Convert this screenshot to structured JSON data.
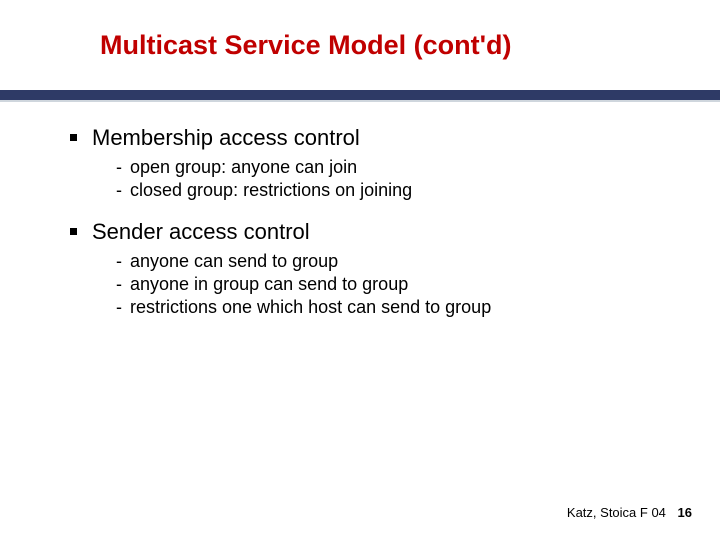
{
  "title": "Multicast Service Model (cont'd)",
  "sections": [
    {
      "heading": "Membership access control",
      "items": [
        "open group: anyone can join",
        "closed group: restrictions on joining"
      ]
    },
    {
      "heading": "Sender access control",
      "items": [
        "anyone can send to group",
        "anyone in group can send to group",
        "restrictions one which host can send to group"
      ]
    }
  ],
  "footer": {
    "attribution": "Katz, Stoica F 04",
    "page": "16"
  }
}
